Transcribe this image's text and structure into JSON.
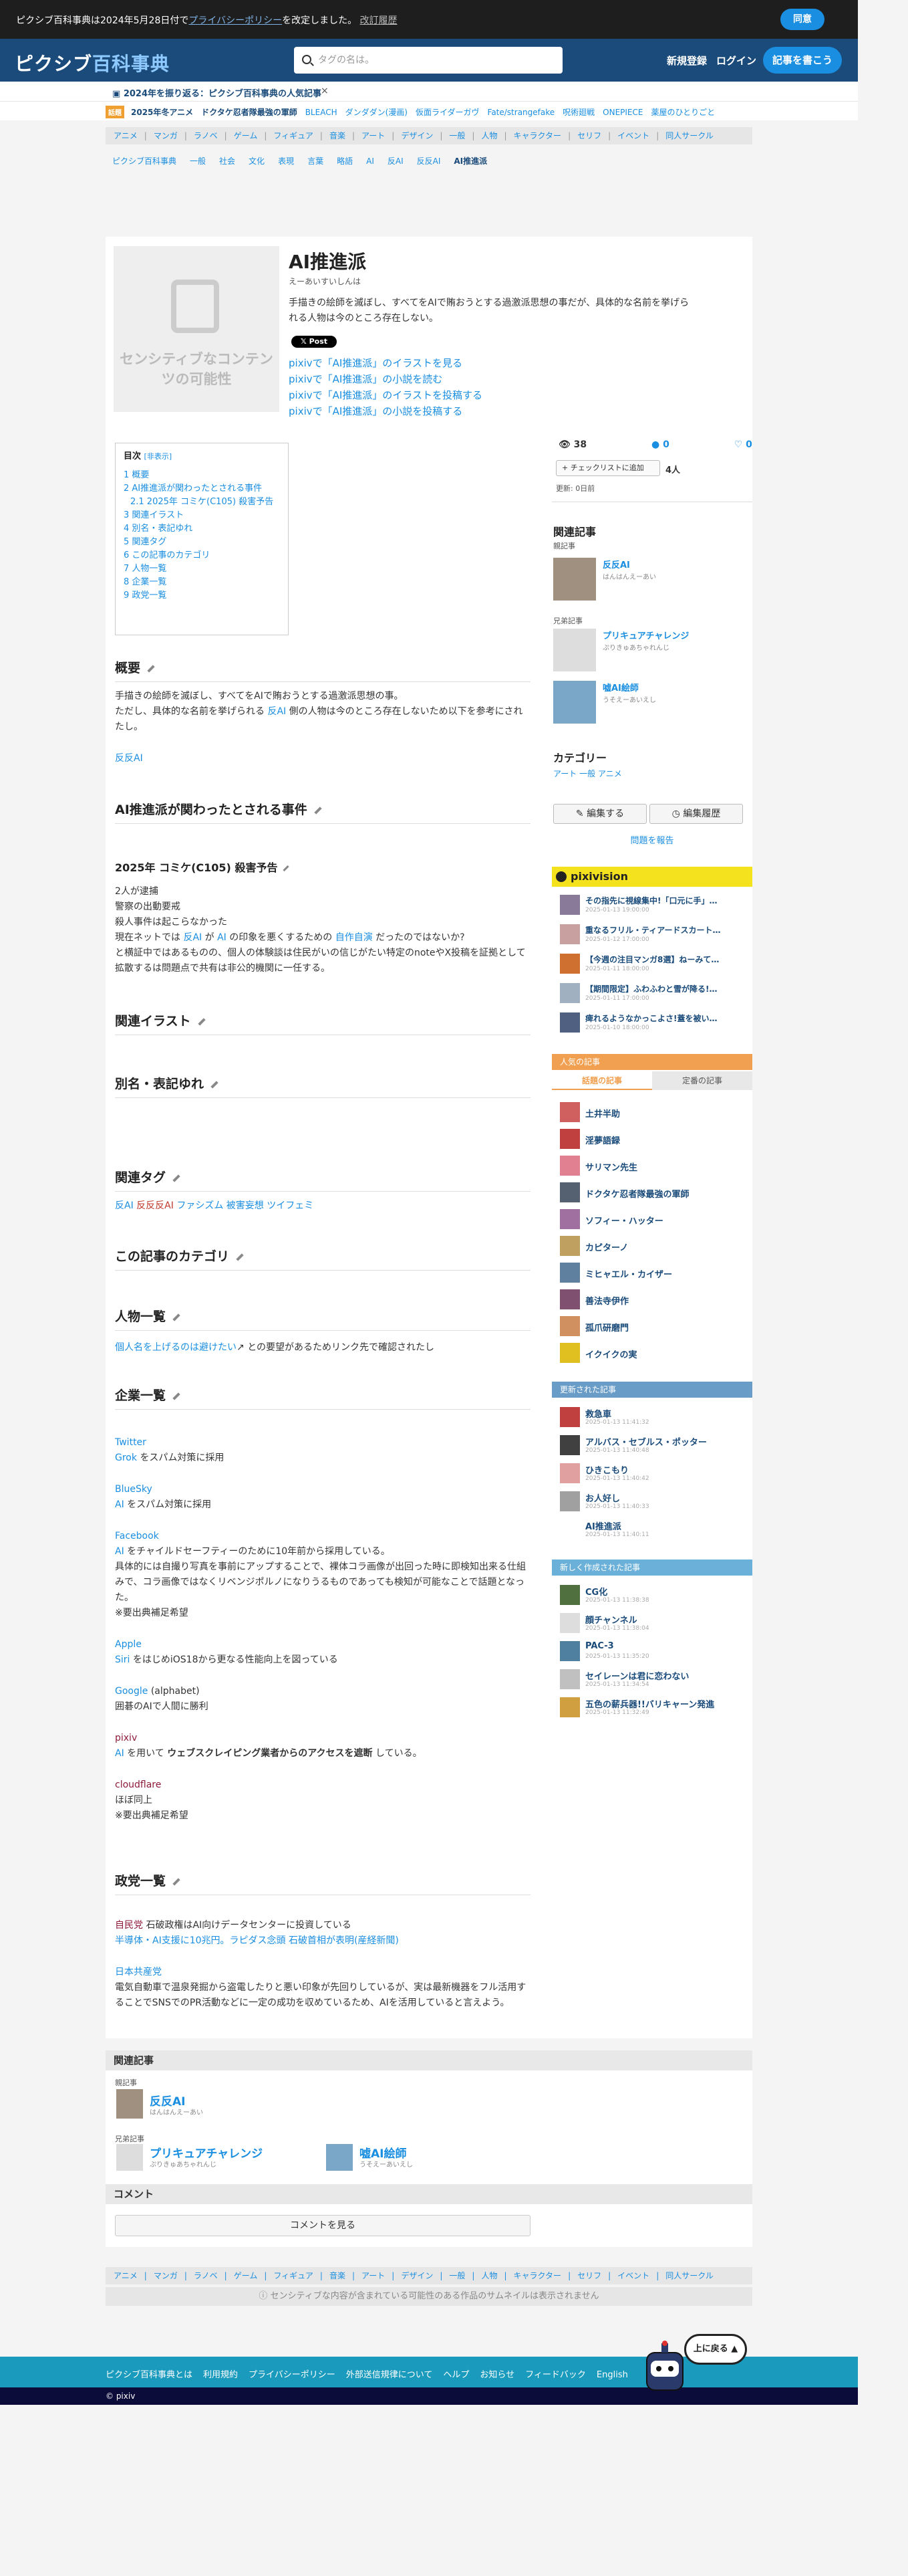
{
  "cookie": {
    "text": "ピクシブ百科事典は2024年5月28日付で",
    "policy": "プライバシーポリシー",
    "after": "を改定しました。",
    "changes": "改訂履歴",
    "agree": "同意"
  },
  "header": {
    "logo1": "ピクシブ",
    "logo2": "百科事典",
    "search_placeholder": "タグの名は。",
    "register": "新規登録",
    "login": "ログイン",
    "write": "記事を書こう"
  },
  "anniv": {
    "text": "2024年を振り返る：ピクシブ百科事典の人気記事",
    "close": "×"
  },
  "trend": {
    "badge": "話題",
    "items": [
      "2025年冬アニメ",
      "ドクタケ忍者隊最強の軍師",
      "BLEACH",
      "ダンダダン(漫画)",
      "仮面ライダーガヴ",
      "Fate/strangefake",
      "呪術廻戦",
      "ONEPIECE",
      "薬屋のひとりごと"
    ]
  },
  "cats": [
    "アニメ",
    "マンガ",
    "ラノベ",
    "ゲーム",
    "フィギュア",
    "音楽",
    "アート",
    "デザイン",
    "一般",
    "人物",
    "キャラクター",
    "セリフ",
    "イベント",
    "同人サークル"
  ],
  "breadcrumb": [
    "ピクシブ百科事典",
    "一般",
    "社会",
    "文化",
    "表現",
    "言葉",
    "略語",
    "AI",
    "反AI",
    "反反AI",
    "AI推進派"
  ],
  "article": {
    "thumb": "センシティブなコンテンツの可能性",
    "title": "AI推進派",
    "yomi": "えーあいすいしんは",
    "desc": "手描きの絵師を滅ぼし、すべてをAIで賄おうとする過激派思想の事だが、具体的な名前を挙げられる人物は今のところ存在しない。",
    "post": "Post",
    "links": [
      "pixivで「AI推進派」のイラストを見る",
      "pixivで「AI推進派」の小説を読む",
      "pixivで「AI推進派」のイラストを投稿する",
      "pixivで「AI推進派」の小説を投稿する"
    ]
  },
  "toc": {
    "title": "目次",
    "toggle": "[非表示]",
    "items": [
      "1 概要",
      "2 AI推進派が関わったとされる事件",
      "2.1 2025年 コミケ(C105) 殺害予告",
      "3 関連イラスト",
      "4 別名・表記ゆれ",
      "5 関連タグ",
      "6 この記事のカテゴリ",
      "7 人物一覧",
      "8 企業一覧",
      "9 政党一覧"
    ]
  },
  "s1": {
    "h": "概要",
    "p1": "手描きの絵師を滅ぼし、すべてをAIで賄おうとする過激派思想の事。",
    "p2a": "ただし、具体的な名前を挙げられる",
    "p2link": "反AI",
    "p2b": "側の人物は今のところ存在しないため以下を参考にされたし。",
    "link": "反反AI"
  },
  "s2": {
    "h": "AI推進派が関わったとされる事件",
    "sub": "2025年 コミケ(C105) 殺害予告",
    "l1": "2人が逮捕",
    "l2": "警察の出動要戒",
    "l3": "殺人事件は起こらなかった",
    "l4a": "現在ネットでは",
    "l4l1": "反AI",
    "l4b": "が",
    "l4l2": "AI",
    "l4c": "の印象を悪くするための",
    "l4l3": "自作自演",
    "l4d": "だったのではないか?",
    "l5": "と横証中ではあるものの、個人の体験談は住民がいの信じがたい特定のnoteやX投稿を証拠として拡散するは問題点で共有は非公的機関に一任する。"
  },
  "s3": {
    "h": "関連イラスト"
  },
  "s4": {
    "h": "別名・表記ゆれ"
  },
  "s5": {
    "h": "関連タグ",
    "tags": [
      "反AI",
      "反反反AI",
      "ファシズム",
      "被害妄想",
      "ツイフェミ"
    ]
  },
  "s6": {
    "h": "この記事のカテゴリ"
  },
  "s7": {
    "h": "人物一覧",
    "p_link": "個人名を上げるのは避けたい",
    "p": "との要望があるためリンク先で確認されたし"
  },
  "s8": {
    "h": "企業一覧",
    "companies": [
      {
        "name": "Twitter",
        "l1": "Grok",
        "t1": "をスパム対策に採用"
      },
      {
        "name": "BlueSky",
        "l1": "AI",
        "t1": "をスパム対策に採用"
      },
      {
        "name": "Facebook",
        "l1": "AI",
        "t1": "をチャイルドセーフティーのために10年前から採用している。",
        "t2": "具体的には自撮り写真を事前にアップすることで、裸体コラ画像が出回った時に即検知出来る仕組みで、コラ画像ではなくリベンジポルノになりうるものであっても検知が可能なことで話題となった。",
        "t3": "※要出典補足希望"
      },
      {
        "name": "Apple",
        "l1": "Siri",
        "t1": "をはじめiOS18から更なる性能向上を図っている"
      },
      {
        "name": "Google",
        "extra": "(alphabet)",
        "t1": "囲碁のAIで人間に勝利"
      },
      {
        "name": "pixiv",
        "l1": "AI",
        "t1": "を用いて",
        "bold": "ウェブスクレイピング業者からのアクセスを遮断",
        "t2": "している。"
      },
      {
        "name": "cloudflare",
        "t1": "ほぼ同上",
        "t2": "※要出典補足希望"
      }
    ]
  },
  "s9": {
    "h": "政党一覧",
    "p1l": "自民党",
    "p1": "石破政権はAI向けデータセンターに投資している",
    "p2l": "半導体・AI支援に10兆円。ラピダス念頭 石破首相が表明(産経新聞)",
    "p3l": "日本共産党",
    "p4": "電気自動車で温泉発掘から盗電したりと悪い印象が先回りしているが、実は最新機器をフル活用することでSNSでのPR活動などに一定の成功を収めているため、AIを活用していると言えよう。"
  },
  "relbottom": {
    "h": "関連記事",
    "lab1": "親記事",
    "a1": "反反AI",
    "a1s": "はんはんえーあい",
    "lab2": "兄弟記事",
    "a2": "プリキュアチャレンジ",
    "a2s": "ぷりきゅあちゃれんじ",
    "a3": "嘘AI絵師",
    "a3s": "うそえーあいえし",
    "comment_h": "コメント",
    "comment_btn": "コメントを見る"
  },
  "side": {
    "views": "38",
    "comments": "0",
    "likes": "0",
    "checklist": "+ チェックリストに追加",
    "people": "4人",
    "updated": "更新: 0日前",
    "rel_h": "関連記事",
    "parent_lab": "親記事",
    "parent": "反反AI",
    "parent_sub": "はんはんえーあい",
    "sib_lab": "兄弟記事",
    "sib1": "プリキュアチャレンジ",
    "sib1s": "ぷりきゅあちゃれんじ",
    "sib2": "嘘AI絵師",
    "sib2s": "うそえーあいえし",
    "cat_h": "カテゴリー",
    "cats": [
      "アート",
      "一般",
      "アニメ"
    ],
    "edit": "編集する",
    "history": "編集履歴",
    "report": "問題を報告"
  },
  "pixivision": {
    "title": "pixivision",
    "items": [
      {
        "t": "その指先に視線集中!「口元に手」…",
        "d": "2025-01-13 19:00:00"
      },
      {
        "t": "重なるフリル・ティアードスカート…",
        "d": "2025-01-12 17:00:00"
      },
      {
        "t": "【今週の注目マンガ8選】ねーみて…",
        "d": "2025-01-11 18:00:00"
      },
      {
        "t": "【期間限定】ふわふわと雪が降る!…",
        "d": "2025-01-11 17:00:00"
      },
      {
        "t": "痺れるようなかっこよさ!蓋を被い…",
        "d": "2025-01-10 18:00:00"
      }
    ]
  },
  "popular": {
    "h": "人気の記事",
    "tab1": "話題の記事",
    "tab2": "定番の記事",
    "items": [
      "土井半助",
      "淫夢語録",
      "サリマン先生",
      "ドクタケ忍者隊最強の軍師",
      "ソフィー・ハッター",
      "カピターノ",
      "ミヒャエル・カイザー",
      "善法寺伊作",
      "孤爪研磨門",
      "イクイクの実"
    ]
  },
  "updated": {
    "h": "更新された記事",
    "items": [
      {
        "t": "救急車",
        "d": "2025-01-13 11:41:32"
      },
      {
        "t": "アルバス・セブルス・ポッター",
        "d": "2025-01-13 11:40:48"
      },
      {
        "t": "ひきこもり",
        "d": "2025-01-13 11:40:42"
      },
      {
        "t": "お人好し",
        "d": "2025-01-13 11:40:33"
      },
      {
        "t": "AI推進派",
        "d": "2025-01-13 11:40:11"
      }
    ]
  },
  "newitems": {
    "h": "新しく作成された記事",
    "items": [
      {
        "t": "CG化",
        "d": "2025-01-13 11:38:38"
      },
      {
        "t": "顔チャンネル",
        "d": "2025-01-13 11:38:04"
      },
      {
        "t": "PAC-3",
        "d": "2025-01-13 11:35:20"
      },
      {
        "t": "セイレーンは君に恋わない",
        "d": "2025-01-13 11:34:54"
      },
      {
        "t": "五色の薪兵器!!バリキャーン発進",
        "d": "2025-01-13 11:32:49"
      }
    ]
  },
  "footer": {
    "sens": "センシティブな内容が含まれている可能性のある作品のサムネイルは表示されません",
    "links": [
      "ピクシブ百科事典とは",
      "利用規約",
      "プライバシーポリシー",
      "外部送信規律について",
      "ヘルプ",
      "お知らせ",
      "フィードバック",
      "English"
    ],
    "copy": "© pixiv",
    "totop": "上に戻る"
  }
}
